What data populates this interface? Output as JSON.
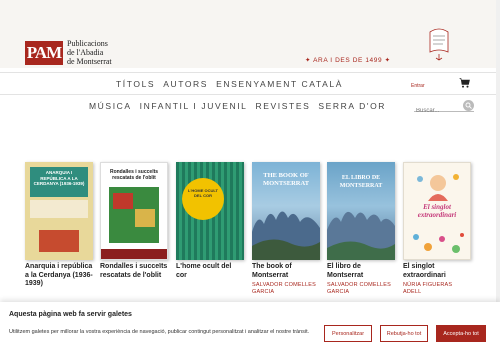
{
  "header": {
    "logo_mark": "PAM",
    "logo_line1": "Publicacions",
    "logo_line2": "de l'Abadia",
    "logo_line3": "de Montserrat",
    "tagline": "✦ ARA I DES DE 1499 ✦",
    "brand_color": "#a8271e"
  },
  "nav": {
    "row1": [
      "TÍTOLS",
      "AUTORS",
      "ENSENYAMENT CATALÀ"
    ],
    "row2": [
      "MÚSICA",
      "INFANTIL I JUVENIL",
      "REVISTES",
      "SERRA D'OR"
    ],
    "login_label": "Entrar",
    "search_placeholder": "Buscar..."
  },
  "books": [
    {
      "title": "Anarquia i república a la Cerdanya (1936-1939)",
      "author": "",
      "cover_text": "ANARQUIA I REPÚBLICA A LA CERDANYA (1936-1939)"
    },
    {
      "title": "Rondalles i succeïts rescatats de l'oblit",
      "author": "",
      "cover_text": "Rondalles i succeïts rescatats de l'oblit"
    },
    {
      "title": "L'home ocult del cor",
      "author": "",
      "cover_text": "L'HOME OCULT DEL COR"
    },
    {
      "title": "The book of Montserrat",
      "author": "SALVADOR COMELLES GARCIA",
      "cover_text": "THE BOOK OF MONTSERRAT"
    },
    {
      "title": "El libro de Montserrat",
      "author": "SALVADOR COMELLES GARCIA",
      "cover_text": "EL LIBRO DE MONTSERRAT"
    },
    {
      "title": "El singlot extraordinari",
      "author": "NÚRIA FIGUERAS ADELL",
      "cover_text": "El singlot extraordinari"
    }
  ],
  "cookie": {
    "title": "Aquesta pàgina web fa servir galetes",
    "text": "Utilitzem galetes per millorar la vostra experiència de navegació, publicar contingut personalitzat i analitzar el nostre trànsit.",
    "customize_label": "Personalitzar",
    "reject_label": "Rebutja-ho tot",
    "accept_label": "Accepta-ho tot"
  }
}
